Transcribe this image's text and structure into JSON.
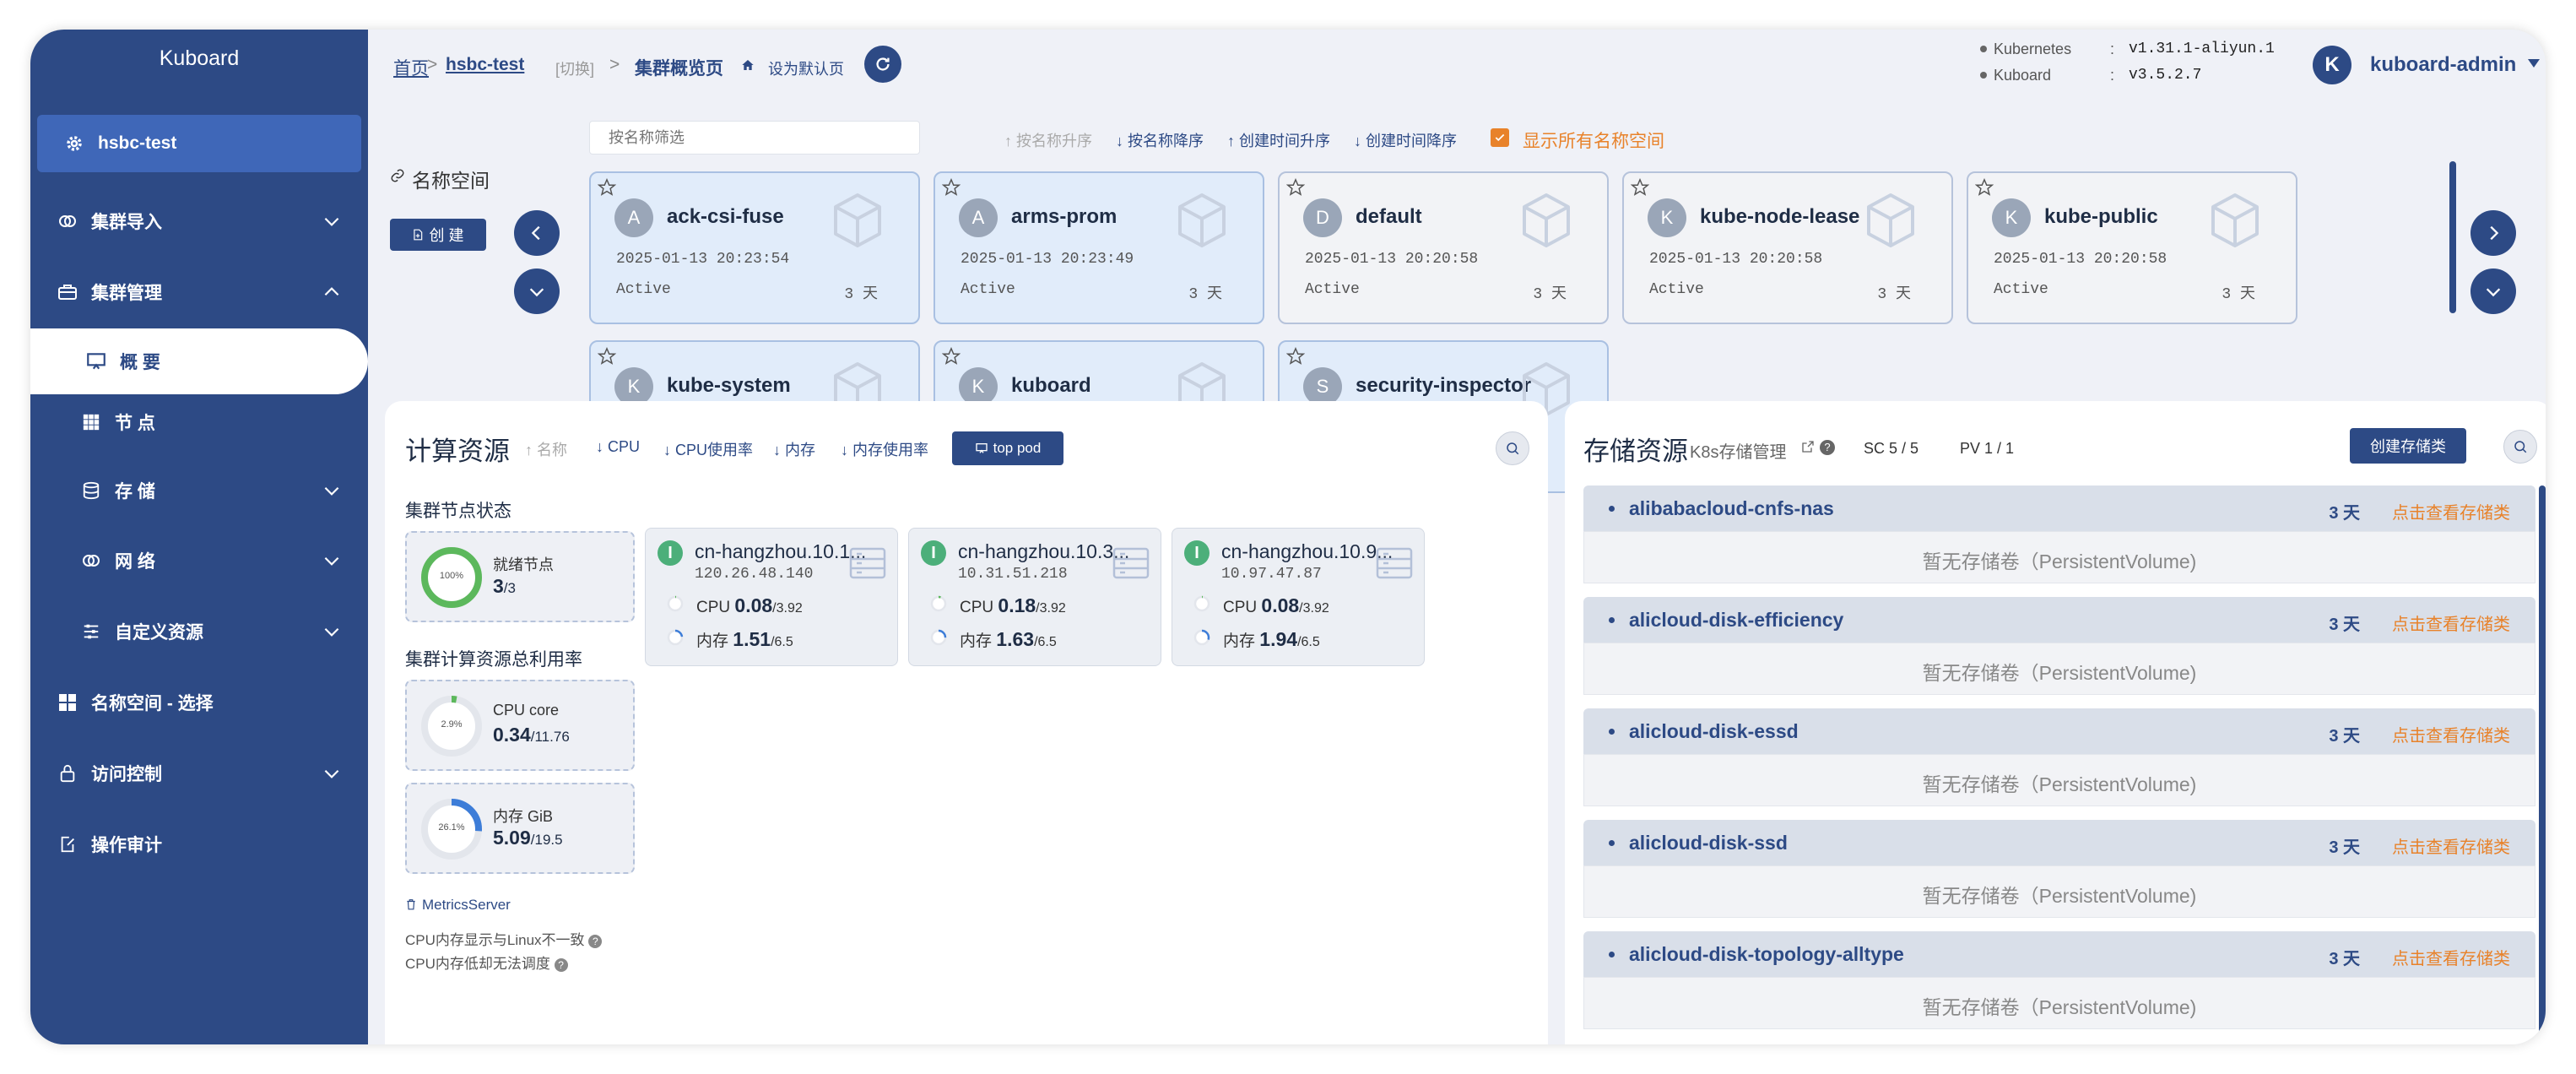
{
  "sidebar": {
    "brand": "Kuboard",
    "cluster": "hsbc-test",
    "items": [
      {
        "label": "集群导入"
      },
      {
        "label": "集群管理"
      },
      {
        "label": "概 要"
      },
      {
        "label": "节 点"
      },
      {
        "label": "存 储"
      },
      {
        "label": "网 络"
      },
      {
        "label": "自定义资源"
      },
      {
        "label": "名称空间 - 选择"
      },
      {
        "label": "访问控制"
      },
      {
        "label": "操作审计"
      }
    ]
  },
  "header": {
    "crumb_home": "首页",
    "crumb_cluster": "hsbc-test",
    "crumb_switch": "[切换]",
    "crumb_page": "集群概览页",
    "set_default": "设为默认页",
    "k8s_label": "Kubernetes",
    "k8s_version": "v1.31.1-aliyun.1",
    "kb_label": "Kuboard",
    "kb_version": "v3.5.2.7",
    "sep": ":",
    "user_initial": "K",
    "user": "kuboard-admin"
  },
  "namespaces": {
    "title": "名称空间",
    "create_label": "创 建",
    "filter_placeholder": "按名称筛选",
    "sort": [
      "按名称升序",
      "按名称降序",
      "创建时间升序",
      "创建时间降序"
    ],
    "show_all_label": "显示所有名称空间",
    "cards": [
      {
        "initial": "A",
        "name": "ack-csi-fuse",
        "created": "2025-01-13 20:23:54",
        "status": "Active",
        "age": "3 天"
      },
      {
        "initial": "A",
        "name": "arms-prom",
        "created": "2025-01-13 20:23:49",
        "status": "Active",
        "age": "3 天"
      },
      {
        "initial": "D",
        "name": "default",
        "created": "2025-01-13 20:20:58",
        "status": "Active",
        "age": "3 天"
      },
      {
        "initial": "K",
        "name": "kube-node-lease",
        "created": "2025-01-13 20:20:58",
        "status": "Active",
        "age": "3 天"
      },
      {
        "initial": "K",
        "name": "kube-public",
        "created": "2025-01-13 20:20:58",
        "status": "Active",
        "age": "3 天"
      },
      {
        "initial": "K",
        "name": "kube-system"
      },
      {
        "initial": "K",
        "name": "kuboard"
      },
      {
        "initial": "S",
        "name": "security-inspector"
      }
    ]
  },
  "compute": {
    "title": "计算资源",
    "sort": [
      "名称",
      "CPU",
      "CPU使用率",
      "内存",
      "内存使用率"
    ],
    "top_pod_label": "top pod",
    "node_status_title": "集群节点状态",
    "ready_pct": "100%",
    "ready_fraction": 1.0,
    "ready_label": "就绪节点",
    "ready_count": "3",
    "ready_total": "/3",
    "usage_title": "集群计算资源总利用率",
    "cpu_pct": "2.9%",
    "cpu_fraction": 0.029,
    "cpu_label": "CPU core",
    "cpu_used": "0.34",
    "cpu_total": "/11.76",
    "mem_pct": "26.1%",
    "mem_fraction": 0.261,
    "mem_label": "内存 GiB",
    "mem_used": "5.09",
    "mem_total": "/19.5",
    "metrics_label": "MetricsServer",
    "note1": "CPU内存显示与Linux不一致",
    "note2": "CPU内存低却无法调度",
    "cpu_row_label": "CPU",
    "mem_row_label": "内存",
    "nodes": [
      {
        "name": "cn-hangzhou.10.1...",
        "ip": "120.26.48.140",
        "cpu": "0.08",
        "cpu_total": "/3.92",
        "mem": "1.51",
        "mem_total": "/6.5",
        "cpu_frac": 0.02,
        "mem_frac": 0.23
      },
      {
        "name": "cn-hangzhou.10.3...",
        "ip": "10.31.51.218",
        "cpu": "0.18",
        "cpu_total": "/3.92",
        "mem": "1.63",
        "mem_total": "/6.5",
        "cpu_frac": 0.05,
        "mem_frac": 0.25
      },
      {
        "name": "cn-hangzhou.10.9...",
        "ip": "10.97.47.87",
        "cpu": "0.08",
        "cpu_total": "/3.92",
        "mem": "1.94",
        "mem_total": "/6.5",
        "cpu_frac": 0.02,
        "mem_frac": 0.3
      }
    ]
  },
  "storage": {
    "title": "存储资源",
    "k8s_link": "K8s存储管理",
    "sc_count": "SC 5 / 5",
    "pv_count": "PV 1 / 1",
    "create_label": "创建存储类",
    "empty_label": "暂无存储卷（PersistentVolume)",
    "view_label": "点击查看存储类",
    "classes": [
      {
        "name": "alibabacloud-cnfs-nas",
        "age": "3 天"
      },
      {
        "name": "alicloud-disk-efficiency",
        "age": "3 天"
      },
      {
        "name": "alicloud-disk-essd",
        "age": "3 天"
      },
      {
        "name": "alicloud-disk-ssd",
        "age": "3 天"
      },
      {
        "name": "alicloud-disk-topology-alltype",
        "age": "3 天"
      }
    ]
  },
  "colors": {
    "brand": "#2d4a85",
    "accent": "#e8822a",
    "ok": "#5cb85c",
    "mem": "#3d7dd8"
  }
}
